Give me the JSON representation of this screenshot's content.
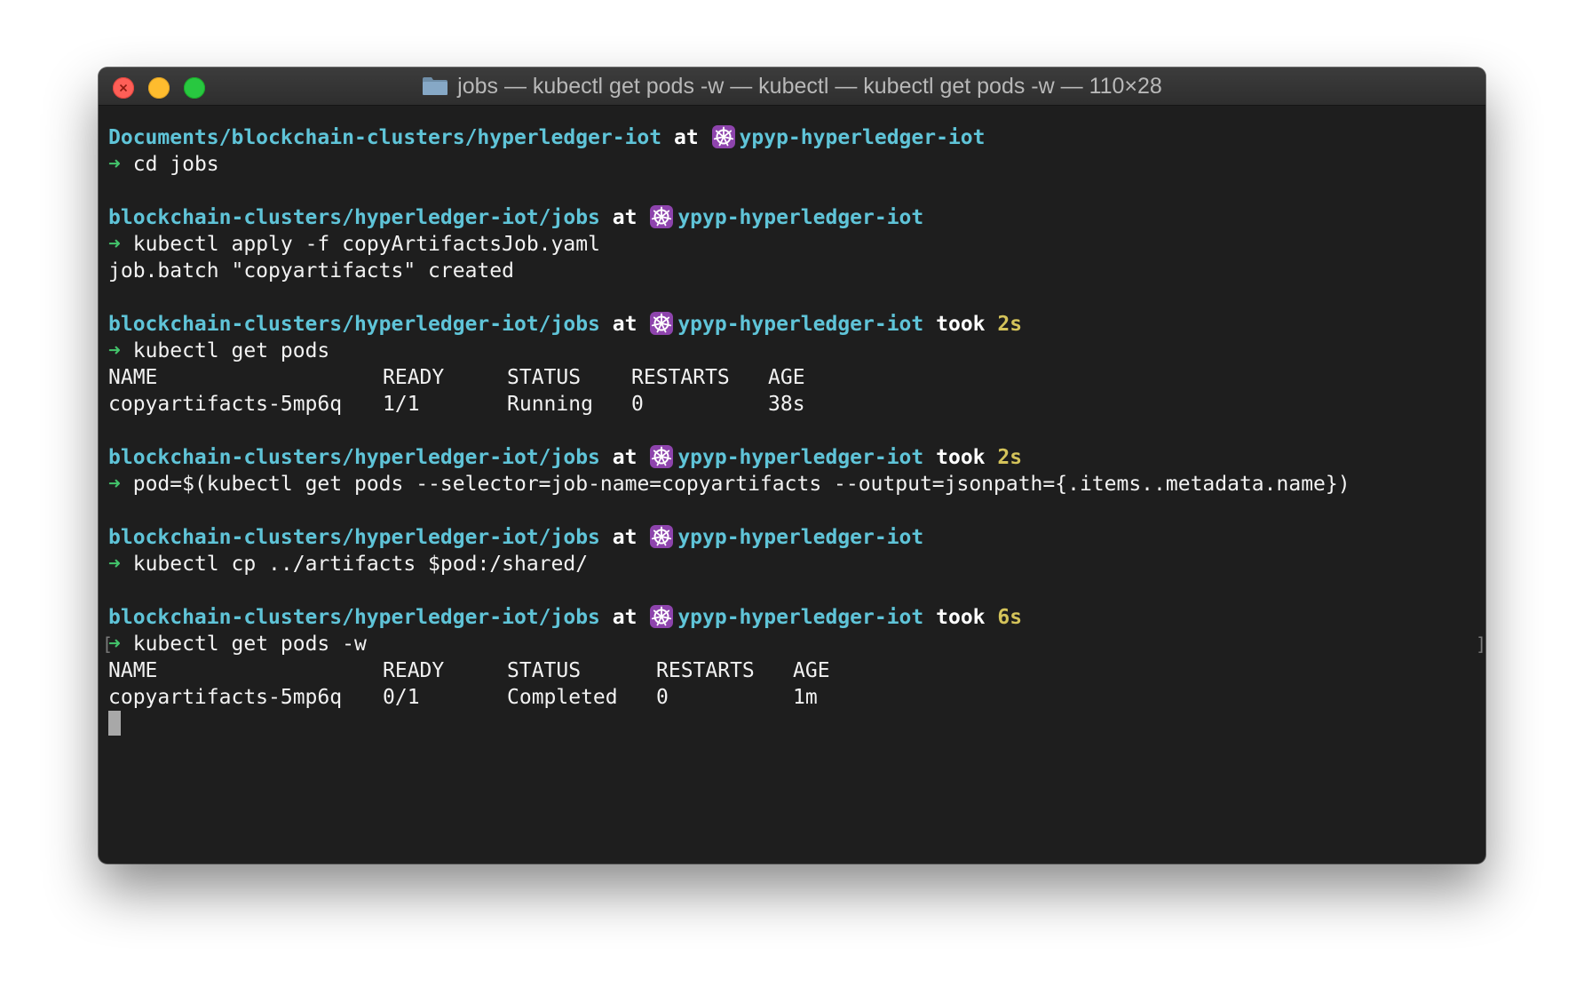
{
  "window": {
    "title": "jobs — kubectl get pods -w — kubectl — kubectl get pods -w — 110×28",
    "traffic_lights": [
      "close",
      "minimize",
      "zoom"
    ],
    "colors": {
      "background": "#1e1e1e",
      "path": "#5fc4d8",
      "arrow": "#43c46b",
      "duration": "#d4c35a"
    }
  },
  "prompt": {
    "at": "at",
    "took": "took",
    "arrow": "➜",
    "context": "ypyp-hyperledger-iot",
    "context_icon": "kubernetes-icon"
  },
  "blocks": [
    {
      "path": "Documents/blockchain-clusters/hyperledger-iot",
      "duration": "",
      "command": "cd jobs",
      "output": []
    },
    {
      "path": "blockchain-clusters/hyperledger-iot/jobs",
      "duration": "",
      "command": "kubectl apply -f copyArtifactsJob.yaml",
      "output": [
        "job.batch \"copyartifacts\" created"
      ]
    },
    {
      "path": "blockchain-clusters/hyperledger-iot/jobs",
      "duration": "2s",
      "command": "kubectl get pods",
      "table": {
        "headers": [
          "NAME",
          "READY",
          "STATUS",
          "RESTARTS",
          "AGE"
        ],
        "rows": [
          [
            "copyartifacts-5mp6q",
            "1/1",
            "Running",
            "0",
            "38s"
          ]
        ]
      }
    },
    {
      "path": "blockchain-clusters/hyperledger-iot/jobs",
      "duration": "2s",
      "command": "pod=$(kubectl get pods --selector=job-name=copyartifacts --output=jsonpath={.items..metadata.name})",
      "output": []
    },
    {
      "path": "blockchain-clusters/hyperledger-iot/jobs",
      "duration": "",
      "command": "kubectl cp ../artifacts $pod:/shared/",
      "output": []
    },
    {
      "path": "blockchain-clusters/hyperledger-iot/jobs",
      "duration": "6s",
      "command": "kubectl get pods -w",
      "table": {
        "headers": [
          "NAME",
          "READY",
          "STATUS",
          "RESTARTS",
          "AGE"
        ],
        "rows": [
          [
            "copyartifacts-5mp6q",
            "0/1",
            "Completed",
            "0",
            "1m"
          ]
        ]
      }
    }
  ]
}
